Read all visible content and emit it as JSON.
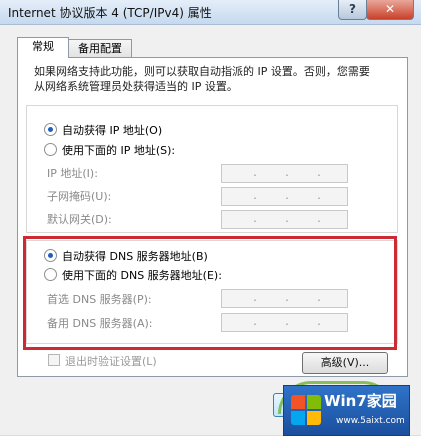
{
  "window": {
    "title": "Internet 协议版本 4 (TCP/IPv4) 属性",
    "help_label": "?",
    "close_label": "✕"
  },
  "tabs": [
    {
      "label": "常规",
      "selected": true
    },
    {
      "label": "备用配置",
      "selected": false
    }
  ],
  "description": "如果网络支持此功能，则可以获取自动指派的 IP 设置。否则，您需要从网络系统管理员处获得适当的 IP 设置。",
  "ip_section": {
    "auto_label": "自动获得 IP 地址(O)",
    "manual_label": "使用下面的 IP 地址(S):",
    "selected": "auto",
    "fields": [
      {
        "label": "IP 地址(I):"
      },
      {
        "label": "子网掩码(U):"
      },
      {
        "label": "默认网关(D):"
      }
    ]
  },
  "dns_section": {
    "auto_label": "自动获得 DNS 服务器地址(B)",
    "manual_label": "使用下面的 DNS 服务器地址(E):",
    "selected": "auto",
    "fields": [
      {
        "label": "首选 DNS 服务器(P):"
      },
      {
        "label": "备用 DNS 服务器(A):"
      }
    ]
  },
  "validate_checkbox": {
    "label": "退出时验证设置(L)",
    "checked": false
  },
  "advanced_button": {
    "label": "高级(V)..."
  },
  "watermark": {
    "title": "Win7家园",
    "url": "www.5aixt.com"
  },
  "colors": {
    "highlight_box": "#cc2b34",
    "watermark_bg": "#1b4f9e"
  }
}
